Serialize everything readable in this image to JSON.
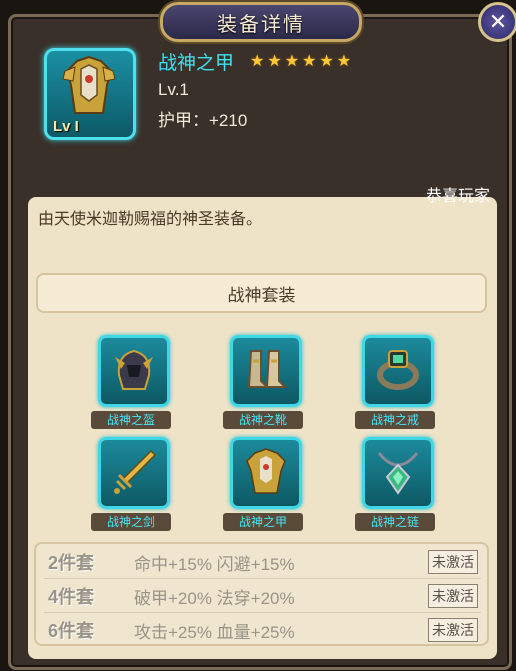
{
  "window": {
    "title": "装备详情",
    "close_icon": "close-icon"
  },
  "item": {
    "name": "战神之甲",
    "stars": 6,
    "level": "Lv.1",
    "armor": "护甲：+210",
    "icon_badge": "Lv I",
    "description": "由天使米迦勒赐福的神圣装备。"
  },
  "notice": "恭喜玩家",
  "set": {
    "name": "战神套装",
    "items": [
      {
        "label": "战神之盔",
        "icon": "helmet-icon"
      },
      {
        "label": "战神之靴",
        "icon": "boots-icon"
      },
      {
        "label": "战神之戒",
        "icon": "ring-icon"
      },
      {
        "label": "战神之剑",
        "icon": "sword-icon"
      },
      {
        "label": "战神之甲",
        "icon": "armor-icon"
      },
      {
        "label": "战神之链",
        "icon": "necklace-icon"
      }
    ],
    "bonuses": [
      {
        "pieces": "2件套",
        "text": "命中+15% 闪避+15%",
        "status": "未激活"
      },
      {
        "pieces": "4件套",
        "text": "破甲+20% 法穿+20%",
        "status": "未激活"
      },
      {
        "pieces": "6件套",
        "text": "攻击+25% 血量+25%",
        "status": "未激活"
      }
    ]
  }
}
